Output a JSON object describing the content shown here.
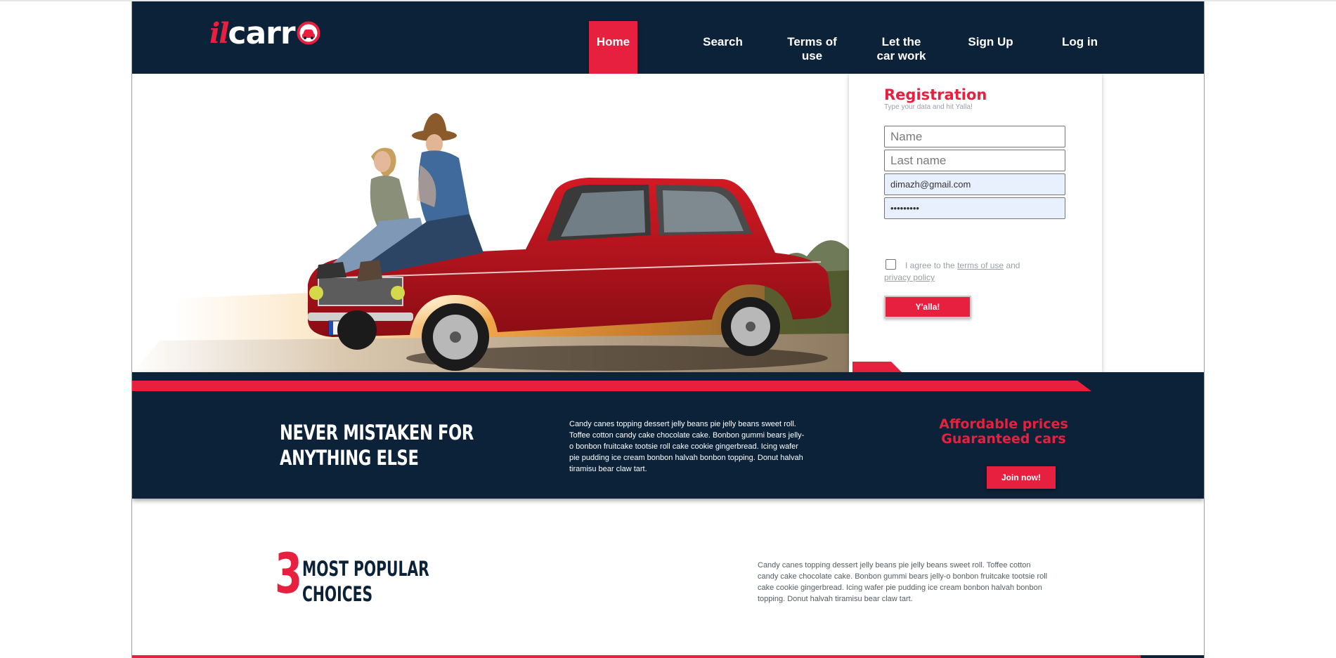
{
  "header": {
    "logo_il": "il",
    "logo_carr": "carr",
    "nav": [
      "Home",
      "Search",
      "Terms of use",
      "Let the car work",
      "Sign Up",
      "Log in"
    ]
  },
  "registration": {
    "title": "Registration",
    "subtitle": "Type your data and hit Yalla!",
    "name_placeholder": "Name",
    "last_name_placeholder": "Last name",
    "email_value": "dimazh@gmail.com",
    "password_value": "•••••••••",
    "agree_prefix": "I agree to the",
    "terms_link": "terms of use",
    "agree_and": "and",
    "privacy_link": "privacy policy",
    "submit": "Y'alla!"
  },
  "band": {
    "heading_line1": "NEVER MISTAKEN FOR",
    "heading_line2": "ANYTHING ELSE",
    "text": "Candy canes topping dessert jelly beans pie jelly beans sweet roll. Toffee cotton candy cake chocolate cake. Bonbon gummi bears jelly-o bonbon fruitcake tootsie roll cake cookie gingerbread. Icing wafer pie pudding ice cream bonbon halvah bonbon topping. Donut halvah tiramisu bear claw tart.",
    "affordable": "Affordable prices",
    "guaranteed": "Guaranteed cars",
    "join": "Join now!"
  },
  "popular": {
    "number": "3",
    "line1": "MOST POPULAR",
    "line2": "CHOICES",
    "text": "Candy canes topping dessert jelly beans pie jelly beans sweet roll. Toffee cotton candy cake chocolate cake. Bonbon gummi bears jelly-o bonbon fruitcake tootsie roll cake cookie gingerbread. Icing wafer pie pudding ice cream bonbon halvah bonbon topping. Donut halvah tiramisu bear claw tart."
  },
  "colors": {
    "navy": "#0c2239",
    "accent": "#e8203f",
    "car_red": "#b3121d"
  }
}
